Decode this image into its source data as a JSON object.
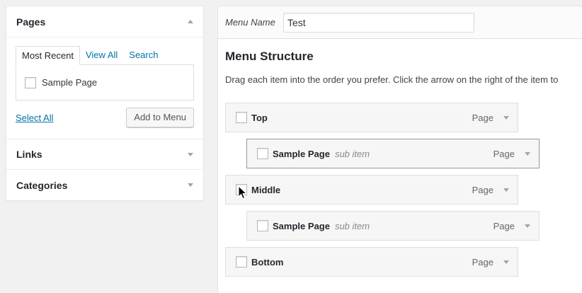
{
  "sidebar": {
    "pages": {
      "title": "Pages",
      "tabs": [
        {
          "label": "Most Recent",
          "active": true
        },
        {
          "label": "View All",
          "active": false
        },
        {
          "label": "Search",
          "active": false
        }
      ],
      "items": [
        {
          "label": "Sample Page",
          "checked": false
        }
      ],
      "select_all": "Select All",
      "add_button": "Add to Menu"
    },
    "links": {
      "title": "Links"
    },
    "categories": {
      "title": "Categories"
    }
  },
  "menu": {
    "name_label": "Menu Name",
    "name_value": "Test",
    "structure_title": "Menu Structure",
    "structure_desc": "Drag each item into the order you prefer. Click the arrow on the right of the item to",
    "items": [
      {
        "title": "Top",
        "sub": "",
        "type": "Page",
        "depth": 0
      },
      {
        "title": "Sample Page",
        "sub": "sub item",
        "type": "Page",
        "depth": 1
      },
      {
        "title": "Middle",
        "sub": "",
        "type": "Page",
        "depth": 0
      },
      {
        "title": "Sample Page",
        "sub": "sub item",
        "type": "Page",
        "depth": 1
      },
      {
        "title": "Bottom",
        "sub": "",
        "type": "Page",
        "depth": 0
      }
    ]
  },
  "colors": {
    "link": "#0073aa",
    "background": "#f1f1f1",
    "panel": "#ffffff",
    "item_bg": "#f6f6f6"
  }
}
